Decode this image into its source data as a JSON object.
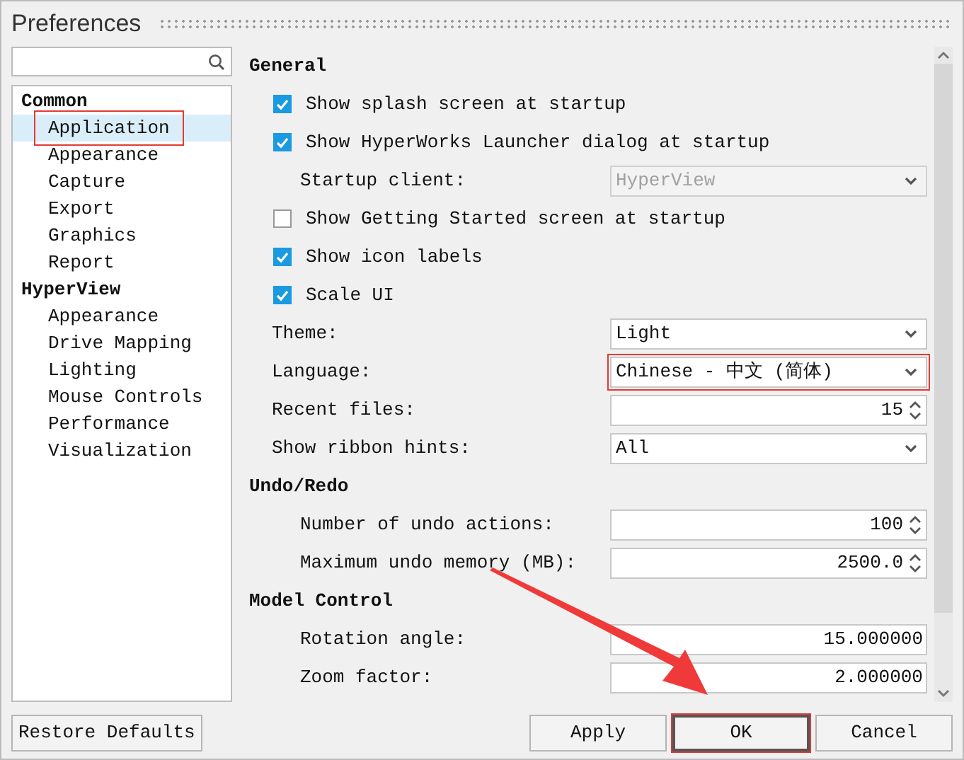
{
  "window": {
    "title": "Preferences"
  },
  "tree": [
    {
      "label": "Common",
      "children": [
        {
          "label": "Application",
          "selected": true,
          "highlighted": true
        },
        {
          "label": "Appearance",
          "selected": false,
          "highlighted": false
        },
        {
          "label": "Capture",
          "selected": false,
          "highlighted": false
        },
        {
          "label": "Export",
          "selected": false,
          "highlighted": false
        },
        {
          "label": "Graphics",
          "selected": false,
          "highlighted": false
        },
        {
          "label": "Report",
          "selected": false,
          "highlighted": false
        }
      ]
    },
    {
      "label": "HyperView",
      "children": [
        {
          "label": "Appearance",
          "selected": false,
          "highlighted": false
        },
        {
          "label": "Drive Mapping",
          "selected": false,
          "highlighted": false
        },
        {
          "label": "Lighting",
          "selected": false,
          "highlighted": false
        },
        {
          "label": "Mouse Controls",
          "selected": false,
          "highlighted": false
        },
        {
          "label": "Performance",
          "selected": false,
          "highlighted": false
        },
        {
          "label": "Visualization",
          "selected": false,
          "highlighted": false
        }
      ]
    }
  ],
  "sections": [
    {
      "title": "General",
      "indented": false,
      "items": [
        {
          "kind": "checkbox",
          "label": "Show splash screen at startup",
          "checked": true
        },
        {
          "kind": "checkbox",
          "label": "Show HyperWorks Launcher dialog at startup",
          "checked": true,
          "children": [
            {
              "kind": "select",
              "label": "Startup client:",
              "value": "HyperView",
              "disabled": true,
              "highlighted": false
            }
          ]
        },
        {
          "kind": "checkbox",
          "label": "Show Getting Started screen at startup",
          "checked": false
        },
        {
          "kind": "checkbox",
          "label": "Show icon labels",
          "checked": true
        },
        {
          "kind": "checkbox",
          "label": "Scale UI",
          "checked": true
        },
        {
          "kind": "select",
          "label": "Theme:",
          "value": "Light",
          "disabled": false,
          "highlighted": false
        },
        {
          "kind": "select",
          "label": "Language:",
          "value": "Chinese - 中文 (简体)",
          "disabled": false,
          "highlighted": true
        },
        {
          "kind": "spin",
          "label": "Recent files:",
          "value": "15"
        },
        {
          "kind": "select",
          "label": "Show ribbon hints:",
          "value": "All",
          "disabled": false,
          "highlighted": false
        }
      ]
    },
    {
      "title": "Undo/Redo",
      "indented": true,
      "items": [
        {
          "kind": "spin",
          "label": "Number of undo actions:",
          "value": "100"
        },
        {
          "kind": "spin",
          "label": "Maximum undo memory (MB):",
          "value": "2500.0"
        }
      ]
    },
    {
      "title": "Model Control",
      "indented": true,
      "items": [
        {
          "kind": "text",
          "label": "Rotation angle:",
          "value": "15.000000"
        },
        {
          "kind": "text",
          "label": "Zoom factor:",
          "value": "2.000000"
        }
      ]
    }
  ],
  "buttons": [
    {
      "label": "Restore Defaults",
      "highlighted": false
    },
    {
      "label": "Apply",
      "highlighted": false
    },
    {
      "label": "OK",
      "highlighted": true
    },
    {
      "label": "Cancel",
      "highlighted": false
    }
  ],
  "annotation_arrow": true
}
